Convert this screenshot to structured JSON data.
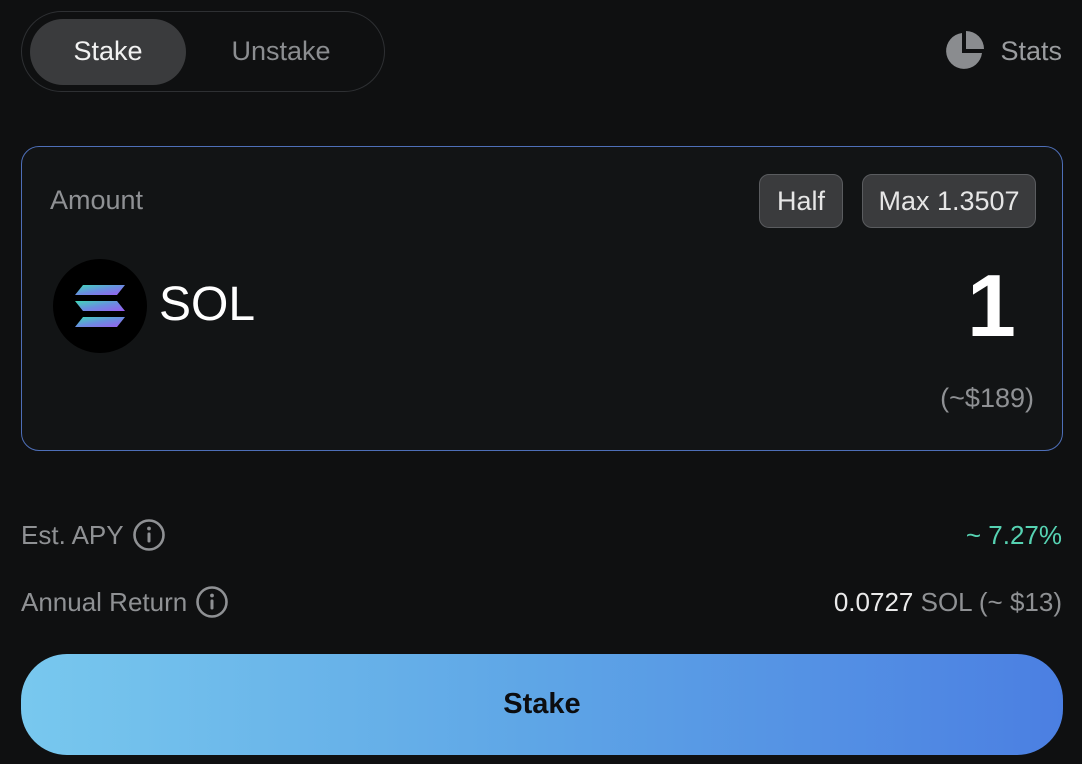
{
  "tabs": [
    {
      "label": "Stake",
      "active": true
    },
    {
      "label": "Unstake",
      "active": false
    }
  ],
  "stats": {
    "label": "Stats",
    "icon": "pie-chart-icon"
  },
  "amount_card": {
    "label": "Amount",
    "half_label": "Half",
    "max_label": "Max 1.3507",
    "token_symbol": "SOL",
    "token_icon": "solana-logo-icon",
    "amount": "1",
    "usd_value": "(~$189)"
  },
  "info": {
    "apy": {
      "label": "Est. APY",
      "value": "~ 7.27%",
      "icon": "info-icon"
    },
    "annual_return": {
      "label": "Annual Return",
      "amount": "0.0727",
      "unit": " SOL (~ $13)",
      "icon": "info-icon"
    }
  },
  "action_button": {
    "label": "Stake"
  },
  "colors": {
    "accent_green": "#56d2b2",
    "card_border": "#4e6fb8",
    "button_gradient_start": "#78c8ee",
    "button_gradient_end": "#4b7fe2",
    "background": "#0f1011"
  }
}
